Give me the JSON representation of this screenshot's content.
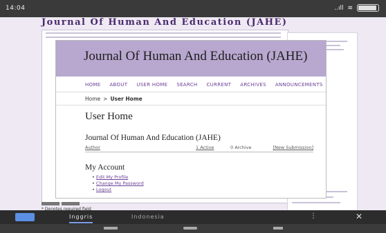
{
  "status": {
    "time": "14:04",
    "signal": "..ıll"
  },
  "bg": {
    "header": "Journal Of Human And Education (JAHE)"
  },
  "page": {
    "title": "Journal Of Human And Education (JAHE)",
    "nav": [
      "HOME",
      "ABOUT",
      "USER HOME",
      "SEARCH",
      "CURRENT",
      "ARCHIVES",
      "ANNOUNCEMENTS"
    ],
    "breadcrumb": {
      "home": "Home",
      "sep": ">",
      "current": "User Home"
    },
    "heading": "User Home",
    "journal_name": "Journal Of Human And Education (JAHE)",
    "role_row": {
      "role": "Author",
      "active": "1 Active",
      "archive": "0 Archive",
      "new_submission": "[New Submission]"
    },
    "account_heading": "My Account",
    "account_links": [
      "Edit My Profile",
      "Change My Password",
      "Logout"
    ]
  },
  "bottom_note": "* Denotes required field",
  "translate": {
    "lang_active": "Inggris",
    "lang_other": "Indonesia"
  }
}
